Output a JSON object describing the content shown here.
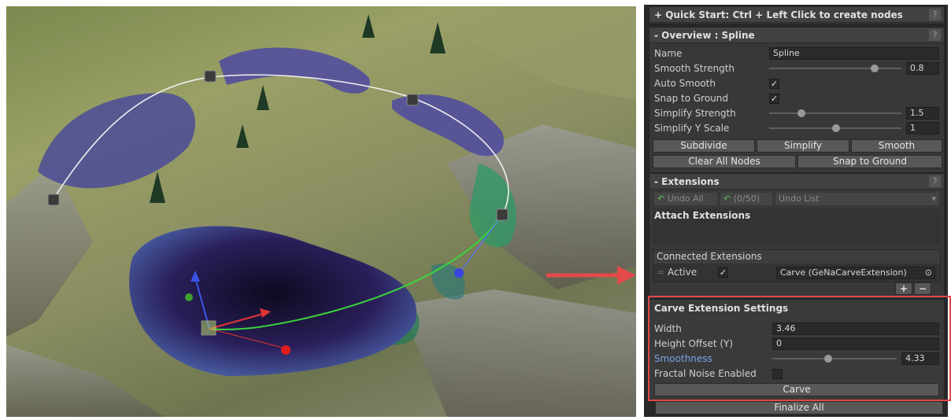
{
  "quickstart": {
    "title": "+ Quick Start: Ctrl + Left Click to create nodes",
    "help": "?"
  },
  "overview": {
    "title": "- Overview : Spline",
    "help": "?",
    "name_label": "Name",
    "name_value": "Spline",
    "smooth_strength_label": "Smooth Strength",
    "smooth_strength_value": "0.8",
    "smooth_strength_level": 0.8,
    "auto_smooth_label": "Auto Smooth",
    "auto_smooth_checked": true,
    "snap_label": "Snap to Ground",
    "snap_checked": true,
    "simplify_strength_label": "Simplify Strength",
    "simplify_strength_value": "1.5",
    "simplify_y_label": "Simplify Y Scale",
    "simplify_y_value": "1",
    "check_glyph": "✓",
    "buttons": {
      "subdivide": "Subdivide",
      "simplify": "Simplify",
      "smooth": "Smooth",
      "clear": "Clear All Nodes",
      "snap": "Snap to Ground"
    }
  },
  "extensions": {
    "title": "- Extensions",
    "help": "?",
    "undo_all": "Undo All",
    "undo_count": "(0/50)",
    "undo_list": "Undo List",
    "undo_icon": "↶",
    "dropdown_icon": "▾",
    "attach_label": "Attach Extensions",
    "connected_label": "Connected Extensions",
    "active_label": "Active",
    "active_checked": true,
    "extension_value": "Carve (GeNaCarveExtension)",
    "add_label": "+",
    "remove_label": "−",
    "drag_glyph": "=",
    "target_glyph": "⊙"
  },
  "carve": {
    "title": "Carve Extension Settings",
    "width_label": "Width",
    "width_value": "3.46",
    "height_label": "Height Offset (Y)",
    "height_value": "0",
    "smoothness_label": "Smoothness",
    "smoothness_value": "4.33",
    "fractal_label": "Fractal Noise Enabled",
    "fractal_checked": false,
    "carve_button": "Carve"
  },
  "finalize_button": "Finalize All",
  "colors": {
    "highlight_red": "#e04848",
    "smoothness_blue": "#7aa6e8"
  }
}
